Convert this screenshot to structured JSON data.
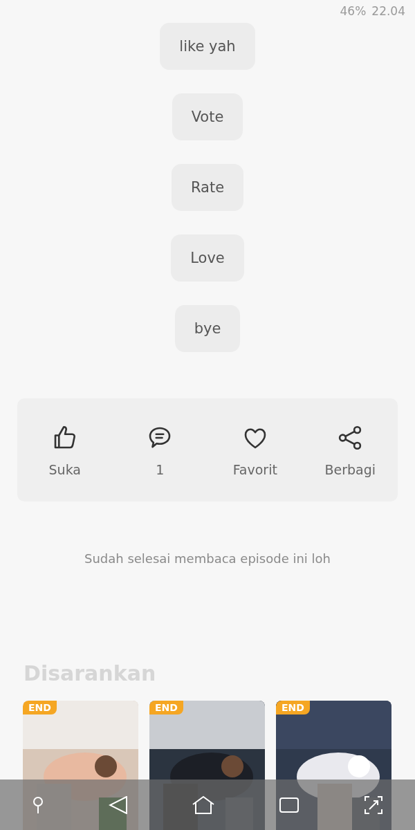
{
  "status_bar": {
    "battery": "46%",
    "time": "22.04"
  },
  "replies": [
    {
      "text": "like yah"
    },
    {
      "text": "Vote"
    },
    {
      "text": "Rate"
    },
    {
      "text": "Love"
    },
    {
      "text": "bye"
    }
  ],
  "actions": [
    {
      "kind": "like",
      "label": "Suka"
    },
    {
      "kind": "comment",
      "label": "1"
    },
    {
      "kind": "favorite",
      "label": "Favorit"
    },
    {
      "kind": "share",
      "label": "Berbagi"
    }
  ],
  "end_note": "Sudah selesai membaca episode ini loh",
  "recommended": {
    "title": "Disarankan",
    "books": [
      {
        "badge": "END",
        "kind": "picture"
      },
      {
        "badge": "END",
        "kind": "picture"
      },
      {
        "badge": "END",
        "kind": "picture"
      }
    ]
  }
}
